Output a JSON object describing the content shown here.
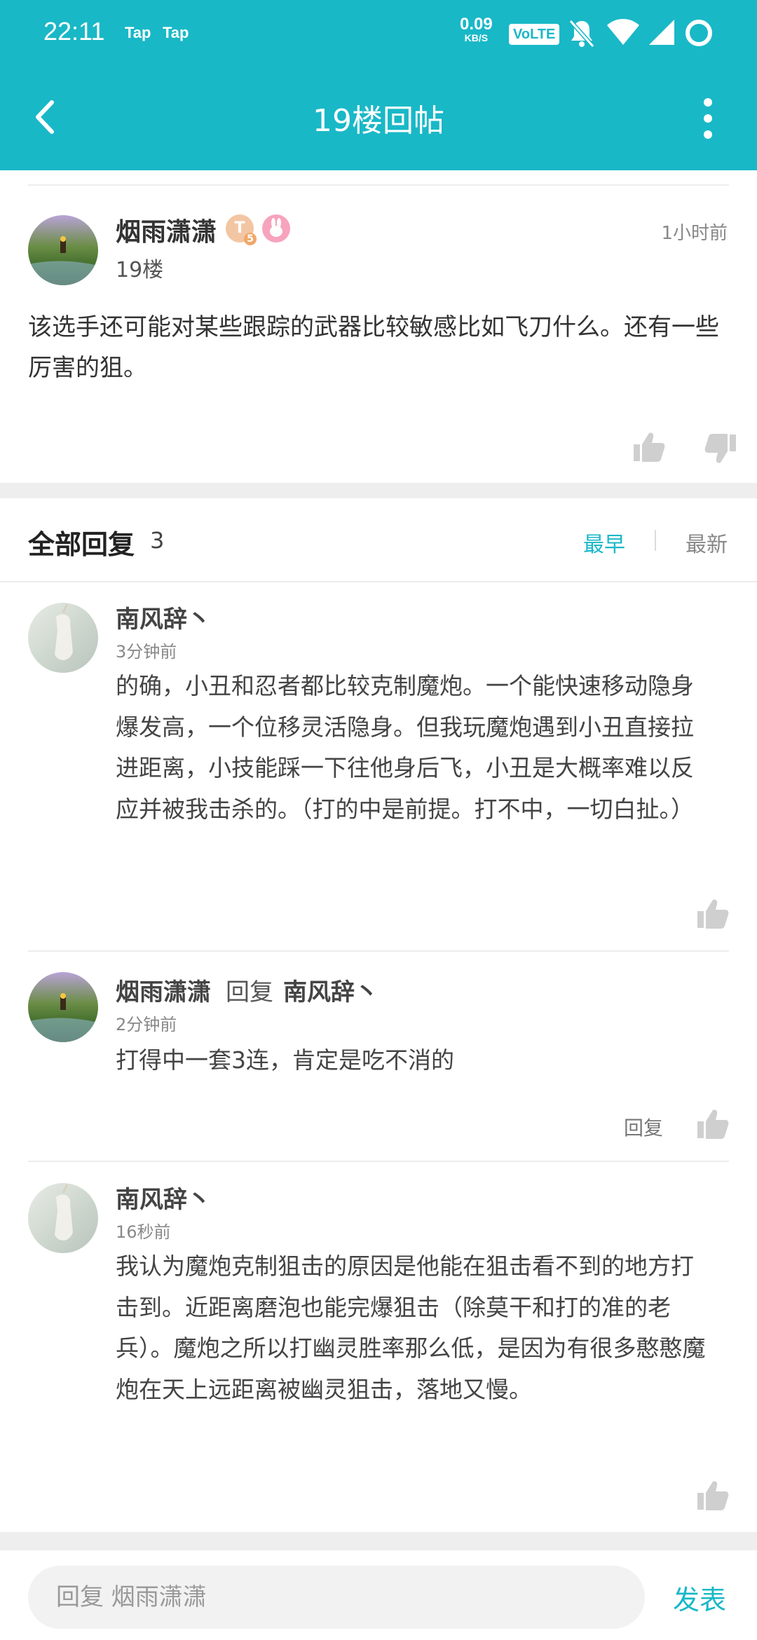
{
  "status_bar": {
    "time": "22:11",
    "app_icons": [
      "Tap",
      "Tap"
    ],
    "net_speed": "0.09",
    "net_unit": "KB/S",
    "volte": "VoLTE"
  },
  "toolbar": {
    "title": "19楼回帖"
  },
  "post": {
    "username": "烟雨潇潇",
    "badge_level": "T",
    "badge_sub": "5",
    "floor": "19楼",
    "time": "1小时前",
    "content": "该选手还可能对某些跟踪的武器比较敏感比如飞刀什么。还有一些厉害的狙。"
  },
  "replies_header": {
    "title": "全部回复",
    "count": "3",
    "sort_earliest": "最早",
    "sort_newest": "最新"
  },
  "replies": [
    {
      "username": "南风辞丶",
      "time": "3分钟前",
      "content": "的确，小丑和忍者都比较克制魔炮。一个能快速移动隐身爆发高，一个位移灵活隐身。但我玩魔炮遇到小丑直接拉进距离，小技能踩一下往他身后飞，小丑是大概率难以反应并被我击杀的。（打的中是前提。打不中，一切白扯。）"
    },
    {
      "username": "烟雨潇潇",
      "reply_word": "回复",
      "reply_target": "南风辞丶",
      "time": "2分钟前",
      "content": "打得中一套3连，肯定是吃不消的",
      "reply_link": "回复"
    },
    {
      "username": "南风辞丶",
      "time": "16秒前",
      "content": "我认为魔炮克制狙击的原因是他能在狙击看不到的地方打击到。近距离磨泡也能完爆狙击（除莫干和打的准的老兵）。魔炮之所以打幽灵胜率那么低，是因为有很多憨憨魔炮在天上远距离被幽灵狙击，落地又慢。"
    }
  ],
  "bottom_bar": {
    "input_placeholder": "回复 烟雨潇潇",
    "publish_label": "发表"
  },
  "colors": {
    "accent": "#19b8c7",
    "divider": "#eeeeee",
    "text_primary": "#333333",
    "text_secondary": "#888888"
  }
}
